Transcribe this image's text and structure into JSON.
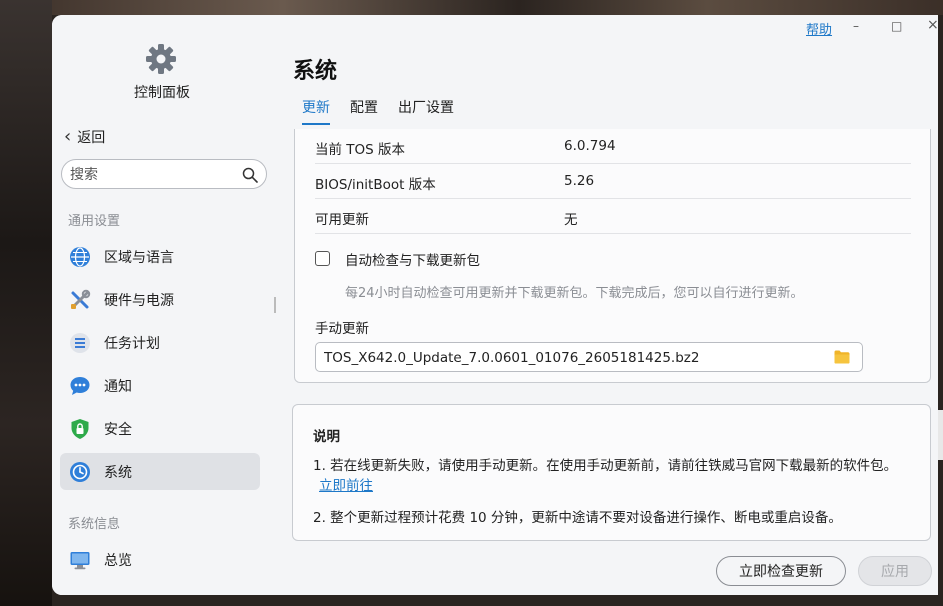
{
  "sidebar": {
    "app_title": "控制面板",
    "back_label": "返回",
    "search_placeholder": "搜索",
    "section_general": "通用设置",
    "section_info": "系统信息",
    "items": [
      {
        "label": "区域与语言",
        "icon": "globe-icon"
      },
      {
        "label": "硬件与电源",
        "icon": "tools-icon"
      },
      {
        "label": "任务计划",
        "icon": "task-list-icon"
      },
      {
        "label": "通知",
        "icon": "chat-bubble-icon"
      },
      {
        "label": "安全",
        "icon": "shield-icon"
      },
      {
        "label": "系统",
        "icon": "system-clock-icon",
        "active": true
      },
      {
        "label": "总览",
        "icon": "monitor-icon"
      }
    ]
  },
  "header": {
    "help": "帮助",
    "minimize": "–",
    "maximize": "□",
    "close": "×",
    "title": "系统",
    "tabs": [
      {
        "label": "更新",
        "active": true
      },
      {
        "label": "配置"
      },
      {
        "label": "出厂设置"
      }
    ]
  },
  "update": {
    "rows": [
      {
        "key": "当前 TOS 版本",
        "value": "6.0.794"
      },
      {
        "key": "BIOS/initBoot 版本",
        "value": "5.26"
      },
      {
        "key": "可用更新",
        "value": "无"
      }
    ],
    "auto_check_label": "自动检查与下载更新包",
    "auto_check_hint": "每24小时自动检查可用更新并下载更新包。下载完成后，您可以自行进行更新。",
    "manual_label": "手动更新",
    "manual_file": "TOS_X642.0_Update_7.0.0601_01076_2605181425.bz2"
  },
  "notes": {
    "title": "说明",
    "note1": "1. 若在线更新失败，请使用手动更新。在使用手动更新前，请前往铁威马官网下载最新的软件包。",
    "note1_link": "立即前往",
    "note2": "2. 整个更新过程预计花费 10 分钟，更新中途请不要对设备进行操作、断电或重启设备。"
  },
  "buttons": {
    "check_now": "立即检查更新",
    "apply": "应用"
  },
  "colors": {
    "accent": "#1e78c8",
    "active_nav": "#dfe1e5"
  }
}
